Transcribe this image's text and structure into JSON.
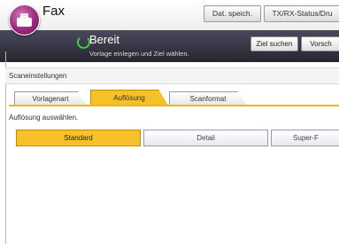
{
  "header": {
    "app_title": "Fax",
    "buttons": [
      "Dat. speich.",
      "TX/RX-Status/Dru"
    ]
  },
  "status": {
    "title": "Bereit",
    "subtitle": "Vorlage einlegen und Ziel wählen.",
    "buttons": [
      "Ziel suchen",
      "Vorsch"
    ]
  },
  "section_title": "Scaneinstellungen",
  "tabs": [
    {
      "label": "Vorlagenart",
      "active": false
    },
    {
      "label": "Auflösung",
      "active": true
    },
    {
      "label": "Scanformat",
      "active": false
    }
  ],
  "instruction": "Auflösung auswählen.",
  "resolution_options": [
    {
      "label": "Standard",
      "selected": true
    },
    {
      "label": "Detail",
      "selected": false
    },
    {
      "label": "Super-F",
      "selected": false
    }
  ],
  "colors": {
    "accent": "#f6c128",
    "status_bg": "#25252f",
    "ready_icon": "#46c84a",
    "logo": "#9c2a7f"
  }
}
